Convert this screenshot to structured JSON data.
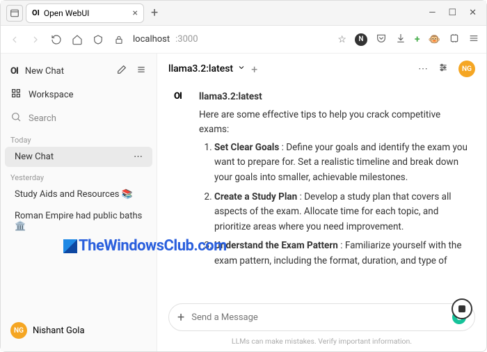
{
  "browser": {
    "tab_title": "Open WebUI",
    "host": "localhost",
    "port": ":3000"
  },
  "sidebar": {
    "new_chat": "New Chat",
    "workspace": "Workspace",
    "search_placeholder": "Search",
    "section_today": "Today",
    "section_yesterday": "Yesterday",
    "items_today": [
      {
        "label": "New Chat"
      }
    ],
    "items_yesterday": [
      {
        "label": "Study Aids and Resources 📚"
      },
      {
        "label": "Roman Empire had public baths 🏛️"
      }
    ],
    "user_name": "Nishant Gola",
    "user_initials": "NG"
  },
  "main": {
    "model_name": "llama3.2:latest",
    "head_initials": "NG",
    "msg_model": "llama3.2:latest",
    "intro": "Here are some effective tips to help you crack competitive exams:",
    "tips": [
      {
        "title": "Set Clear Goals",
        "text": " : Define your goals and identify the exam you want to prepare for. Set a realistic timeline and break down your goals into smaller, achievable milestones."
      },
      {
        "title": "Create a Study Plan",
        "text": " : Develop a study plan that covers all aspects of the exam. Allocate time for each topic, and prioritize areas where you need improvement."
      },
      {
        "title": "Understand the Exam Pattern",
        "text": " : Familiarize yourself with the exam pattern, including the format, duration, and type of"
      }
    ],
    "input_placeholder": "Send a Message",
    "disclaimer": "LLMs can make mistakes. Verify important information."
  },
  "watermark": "TheWindowsClub.com"
}
